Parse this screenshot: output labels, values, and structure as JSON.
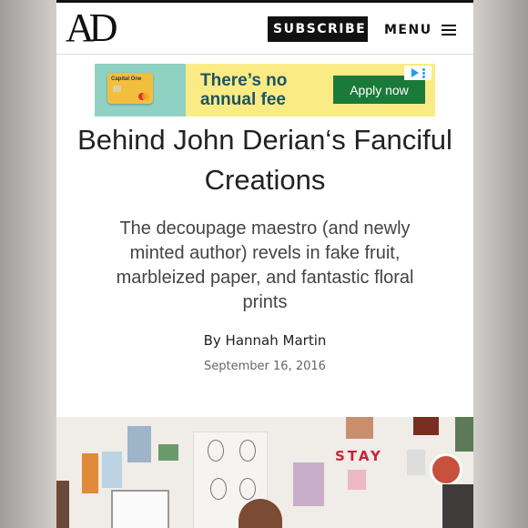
{
  "header": {
    "logo": "AD",
    "subscribe_label": "SUBSCRIBE",
    "menu_label": "MENU"
  },
  "ad": {
    "card_brand": "Capital One",
    "headline": "There’s no annual fee",
    "cta_label": "Apply now",
    "icons": [
      "ad-choices-icon",
      "ad-menu-icon"
    ]
  },
  "article": {
    "title": "Behind John Derian‘s Fanciful Creations",
    "dek": "The decoupage maestro (and newly minted author) revels in fake fruit, marbleized paper, and fantastic floral prints",
    "byline": "By Hannah Martin",
    "date": "September 16, 2016"
  },
  "hero": {
    "collage_text": "STAY",
    "collage_letter_colors": [
      "#c8233a",
      "#3a3a3a",
      "#c8233a",
      "#3a3a3a"
    ]
  }
}
